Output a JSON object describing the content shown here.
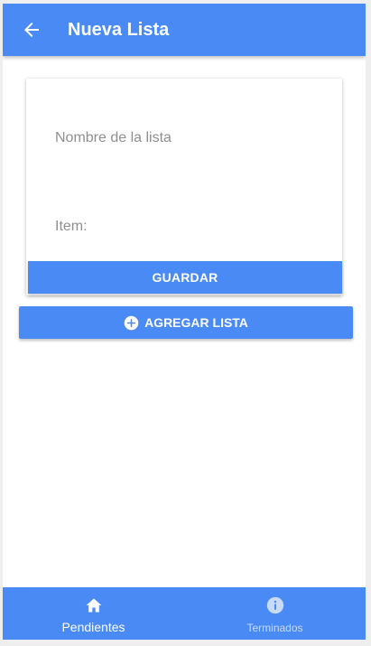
{
  "header": {
    "title": "Nueva Lista",
    "back_icon": "arrow-left-icon"
  },
  "form": {
    "list_name_placeholder": "Nombre de la lista",
    "list_name_value": "",
    "item_placeholder": "Item:",
    "item_value": "",
    "save_label": "GUARDAR"
  },
  "actions": {
    "add_list_label": "AGREGAR LISTA",
    "add_icon": "plus-circle-icon"
  },
  "tabs": [
    {
      "label": "Pendientes",
      "icon": "home-icon",
      "active": true
    },
    {
      "label": "Terminados",
      "icon": "info-icon",
      "active": false
    }
  ],
  "colors": {
    "primary": "#4a8af4",
    "inactive_tab": "#c9dbfb",
    "background": "#ffffff"
  }
}
